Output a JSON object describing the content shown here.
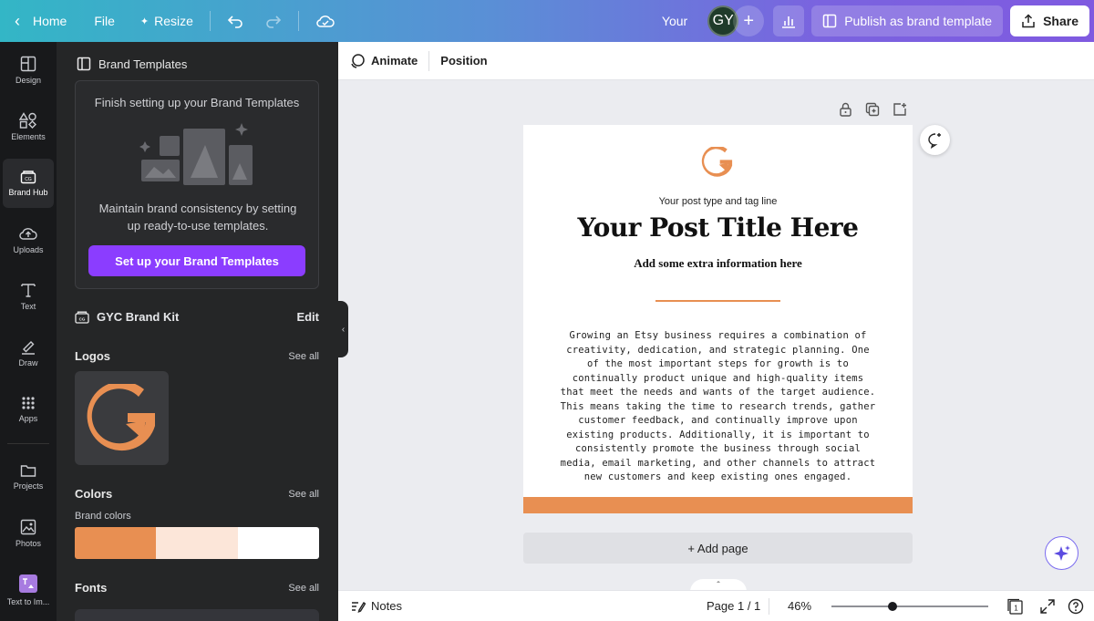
{
  "topbar": {
    "home_label": "Home",
    "file_label": "File",
    "resize_label": "Resize",
    "your_label": "Your",
    "avatar_initials": "GY",
    "publish_label": "Publish as brand template",
    "share_label": "Share"
  },
  "rail": {
    "items": [
      {
        "label": "Design",
        "icon": "layout-icon"
      },
      {
        "label": "Elements",
        "icon": "shapes-icon"
      },
      {
        "label": "Brand Hub",
        "icon": "brand-icon"
      },
      {
        "label": "Uploads",
        "icon": "cloud-upload-icon"
      },
      {
        "label": "Text",
        "icon": "text-icon"
      },
      {
        "label": "Draw",
        "icon": "draw-icon"
      },
      {
        "label": "Apps",
        "icon": "apps-grid-icon"
      },
      {
        "label": "Projects",
        "icon": "folder-icon"
      },
      {
        "label": "Photos",
        "icon": "photo-icon"
      },
      {
        "label": "Text to Im...",
        "icon": "text-to-image-icon"
      }
    ]
  },
  "panel": {
    "title": "Brand Templates",
    "card_title": "Finish setting up your Brand Templates",
    "card_desc": "Maintain brand consistency by setting up ready-to-use templates.",
    "card_button": "Set up your Brand Templates",
    "kit_name": "GYC Brand Kit",
    "kit_edit": "Edit",
    "logos_title": "Logos",
    "colors_title": "Colors",
    "brand_colors_label": "Brand colors",
    "fonts_title": "Fonts",
    "see_all": "See all",
    "colors": [
      "#e88f52",
      "#fce6d9",
      "#ffffff"
    ]
  },
  "toolbar": {
    "animate_label": "Animate",
    "position_label": "Position"
  },
  "canvas": {
    "tagline": "Your post type and tag line",
    "title": "Your Post Title Here",
    "extra": "Add some extra information here",
    "body": "Growing an Etsy business requires a combination of creativity, dedication, and strategic planning. One of the most important steps for growth is to continually product unique and high-quality items that meet the needs and wants of the target audience. This means taking the time to research trends, gather customer feedback, and continually improve upon existing products. Additionally, it is important to consistently promote the business through social media, email marketing, and other channels to attract new customers and keep existing ones engaged.",
    "add_page": "+ Add page",
    "accent_color": "#e88f52"
  },
  "bottombar": {
    "notes_label": "Notes",
    "page_count": "Page 1 / 1",
    "zoom": "46%",
    "pages_badge": "1",
    "zoom_fraction": 0.39
  }
}
